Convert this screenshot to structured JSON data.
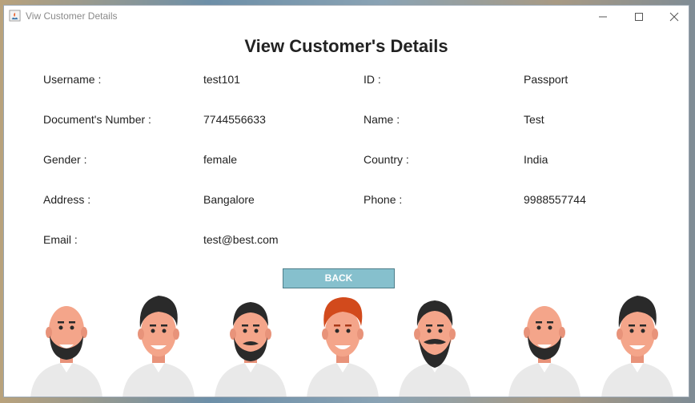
{
  "window": {
    "title": "Viw Customer Details"
  },
  "heading": "View Customer's Details",
  "fields": {
    "username": {
      "label": "Username  :",
      "value": "test101"
    },
    "id": {
      "label": "ID  :",
      "value": "Passport"
    },
    "document_number": {
      "label": "Document's Number  :",
      "value": "7744556633"
    },
    "name": {
      "label": "Name  :",
      "value": "Test"
    },
    "gender": {
      "label": "Gender  :",
      "value": "female"
    },
    "country": {
      "label": "Country  :",
      "value": "India"
    },
    "address": {
      "label": "Address  :",
      "value": "Bangalore"
    },
    "phone": {
      "label": "Phone  :",
      "value": "9988557744"
    },
    "email": {
      "label": "Email  :",
      "value": "test@best.com"
    }
  },
  "buttons": {
    "back": "BACK"
  },
  "colors": {
    "button_bg": "#86c0cd",
    "skin": "#f4a58a",
    "hair": "#2a2a2a",
    "red_hair": "#d24a1c",
    "shirt": "#e9e9e9"
  }
}
